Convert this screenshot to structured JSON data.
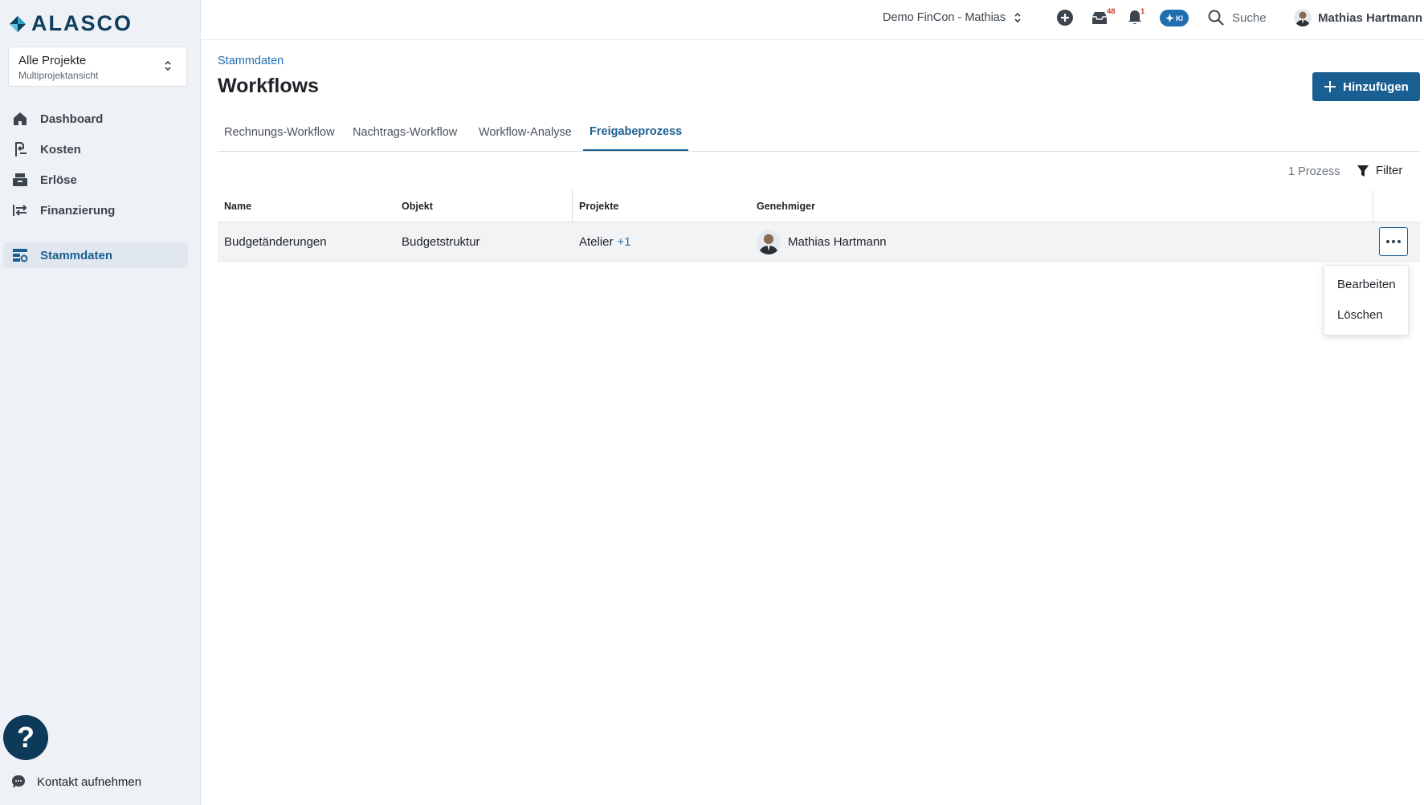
{
  "brand": {
    "name": "ALASCO"
  },
  "project_select": {
    "title": "Alle Projekte",
    "subtitle": "Multiprojektansicht"
  },
  "sidebar": {
    "items": [
      {
        "label": "Dashboard",
        "icon": "home-icon"
      },
      {
        "label": "Kosten",
        "icon": "cost-icon"
      },
      {
        "label": "Erlöse",
        "icon": "revenue-icon"
      },
      {
        "label": "Finanzierung",
        "icon": "financing-icon"
      },
      {
        "label": "Stammdaten",
        "icon": "master-data-icon",
        "active": true
      }
    ],
    "help_label": "?",
    "contact_label": "Kontakt aufnehmen"
  },
  "topbar": {
    "company": "Demo FinCon - Mathias",
    "inbox_badge": "48",
    "notifications_badge": "1",
    "ki_label": "KI",
    "search_label": "Suche",
    "user_name": "Mathias Hartmann"
  },
  "page": {
    "breadcrumb": "Stammdaten",
    "title": "Workflows",
    "add_button": "Hinzufügen"
  },
  "tabs": [
    {
      "label": "Rechnungs-Workflow"
    },
    {
      "label": "Nachtrags-Workflow"
    },
    {
      "label": "Workflow-Analyse"
    },
    {
      "label": "Freigabeprozess",
      "active": true
    }
  ],
  "toolbar": {
    "count": "1 Prozess",
    "filter_label": "Filter"
  },
  "table": {
    "headers": [
      "Name",
      "Objekt",
      "Projekte",
      "Genehmiger"
    ],
    "rows": [
      {
        "name": "Budgetänderungen",
        "object": "Budgetstruktur",
        "projects": "Atelier",
        "projects_more": "+1",
        "approver": "Mathias Hartmann"
      }
    ]
  },
  "row_menu": {
    "items": [
      "Bearbeiten",
      "Löschen"
    ]
  },
  "colors": {
    "accent": "#1a5f91",
    "link": "#1f6fb0",
    "badge": "#d53b2b",
    "sidebar_bg": "#eef1f5"
  }
}
